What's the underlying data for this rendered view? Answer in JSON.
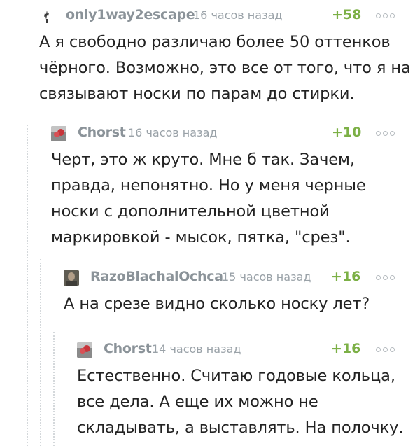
{
  "comments": [
    {
      "author": "only1way2escape",
      "time": "16 часов назад",
      "rating": "+58",
      "lines": [
        "А я свободно различаю более 50 оттенков",
        "чёрного. Возможно, это все от того, что я на",
        "связывают носки по парам до стирки."
      ]
    },
    {
      "author": "Chorst",
      "time": "16 часов назад",
      "rating": "+10",
      "lines": [
        "Черт, это ж круто. Мне б так. Зачем,",
        "правда, непонятно. Но у меня черные",
        "носки с дополнительной цветной",
        "маркировкой - мысок, пятка, \"срез\"."
      ]
    },
    {
      "author": "RazoBlachalOchca",
      "time": "15 часов назад",
      "rating": "+16",
      "lines": [
        "А на срезе видно сколько носку лет?"
      ]
    },
    {
      "author": "Chorst",
      "time": "14 часов назад",
      "rating": "+16",
      "lines": [
        "Естественно. Считаю годовые кольца,",
        "все дела. А еще их можно не",
        "складывать, а выставлять. На полочку."
      ]
    }
  ]
}
